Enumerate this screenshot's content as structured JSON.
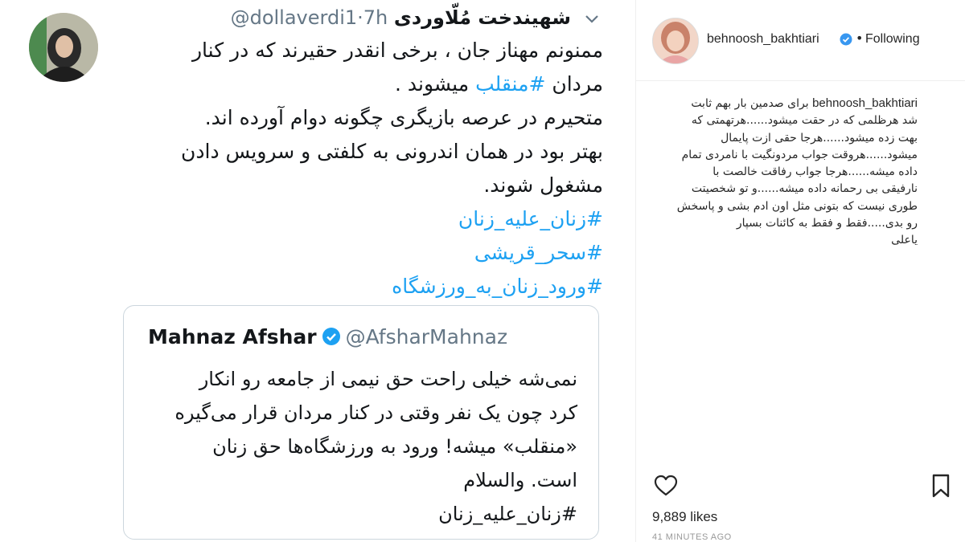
{
  "tweet": {
    "display_name": "شهیندخت مُلّاوردی",
    "handle": "@dollaverdi1",
    "separator": "·",
    "time": "7h",
    "lines": [
      "ممنونم مهناز جان ، برخی انقدر حقیرند که در کنار",
      "میشوند .",
      "متحیرم در عرصه بازیگری چگونه دوام آورده اند.",
      "بهتر بود در همان اندرونی به کلفتی و سرویس دادن",
      "مشغول شوند."
    ],
    "line2_prefix": "مردان",
    "line2_hashtag": "#منقلب",
    "hashtags": [
      "#زنان_علیه_زنان",
      "#سحر_قریشی",
      "#ورود_زنان_به_ورزشگاه"
    ],
    "quoted": {
      "name": "Mahnaz Afshar",
      "handle": "@AfsharMahnaz",
      "lines": [
        "نمی‌شه خیلی راحت حق نیمی از جامعه رو انکار",
        "کرد چون یک نفر وقتی در کنار مردان قرار می‌گیره",
        "«منقلب» میشه! ورود به ورزشگاه‌ها حق زنان",
        "است. والسلام",
        "#زنان_علیه_زنان"
      ]
    }
  },
  "instagram": {
    "username": "behnoosh_bakhtiari",
    "dot": "•",
    "follow_status": "Following",
    "caption_user": "behnoosh_bakhtiari",
    "caption_first": "برای صدمین بار بهم ثابت",
    "caption_lines": [
      "شد هرظلمی که در حقت میشود......هرتهمتی که",
      "بهت زده میشود......هرجا حقی ازت پایمال",
      "میشود......هروقت جواب مردونگیت با نامردی تمام",
      "داده میشه......هرجا جواب رفاقت خالصت با",
      "نارفیقی بی رحمانه داده میشه......و تو شخصیتت",
      "طوری نیست که بتونی مثل اون ادم بشی و پاسخش",
      "رو بدی.....فقط و فقط به کائنات بسپار",
      "یاعلی"
    ],
    "likes": "9,889 likes",
    "timestamp": "41 MINUTES AGO",
    "icons": {
      "like": "heart-icon",
      "save": "bookmark-icon",
      "verified": "verified-badge-icon"
    }
  },
  "colors": {
    "link": "#1da1f2",
    "verified": "#3897f0",
    "text": "#14171a",
    "muted": "#657786"
  }
}
